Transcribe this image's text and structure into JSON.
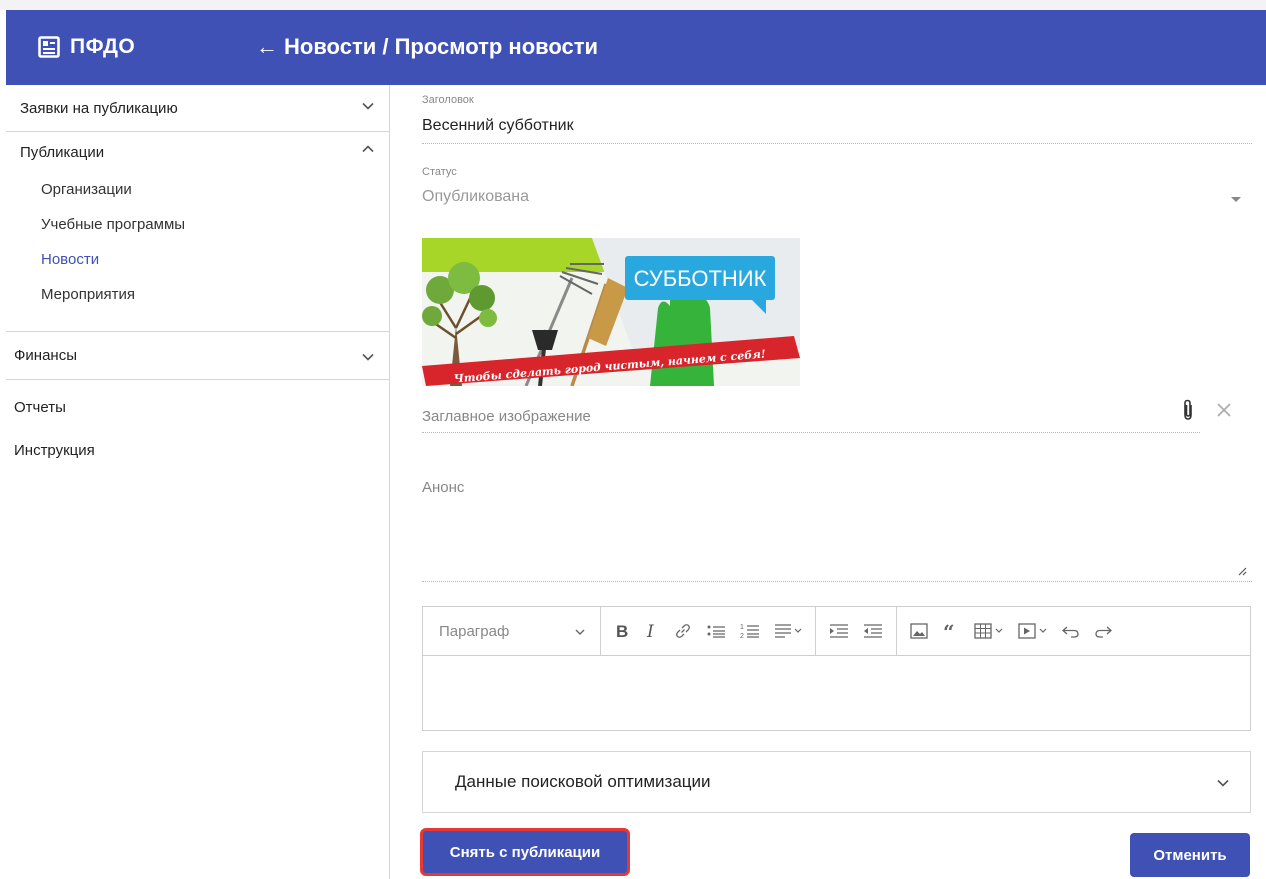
{
  "header": {
    "logo_text": "ПФДО",
    "title": "Новости / Просмотр новости",
    "background": "#3f51b5",
    "icons": {
      "logo": "newspaper-icon",
      "back": "arrow-left-icon"
    }
  },
  "sidebar": {
    "items": [
      {
        "label": "Заявки на публикацию",
        "expanded": false
      },
      {
        "label": "Публикации",
        "expanded": true,
        "children": [
          "Организации",
          "Учебные программы",
          "Новости",
          "Мероприятия"
        ],
        "active_child": "Новости"
      },
      {
        "label": "Финансы",
        "expanded": false
      },
      {
        "label": "Отчеты"
      },
      {
        "label": "Инструкция"
      }
    ],
    "active_color": "#3f51b5"
  },
  "form": {
    "title_label": "Заголовок",
    "title_value": "Весенний субботник",
    "status_label": "Статус",
    "status_value": "Опубликована",
    "image": {
      "banner_text": "СУББОТНИК",
      "ribbon_text": "Чтобы сделать город чистым, начнем с себя!"
    },
    "cover_image_label": "Заглавное изображение",
    "announce_label": "Анонс",
    "editor": {
      "paragraph_select": "Параграф",
      "tools": [
        "bold-icon",
        "italic-icon",
        "link-icon",
        "bulleted-list-icon",
        "numbered-list-icon",
        "align-icon",
        "indent-icon",
        "outdent-icon",
        "image-icon",
        "quote-icon",
        "table-icon",
        "media-icon",
        "undo-icon",
        "redo-icon"
      ]
    },
    "seo_label": "Данные поисковой оптимизации"
  },
  "actions": {
    "unpublish_label": "Снять с публикации",
    "cancel_label": "Отменить",
    "highlight_color": "#e53935"
  }
}
